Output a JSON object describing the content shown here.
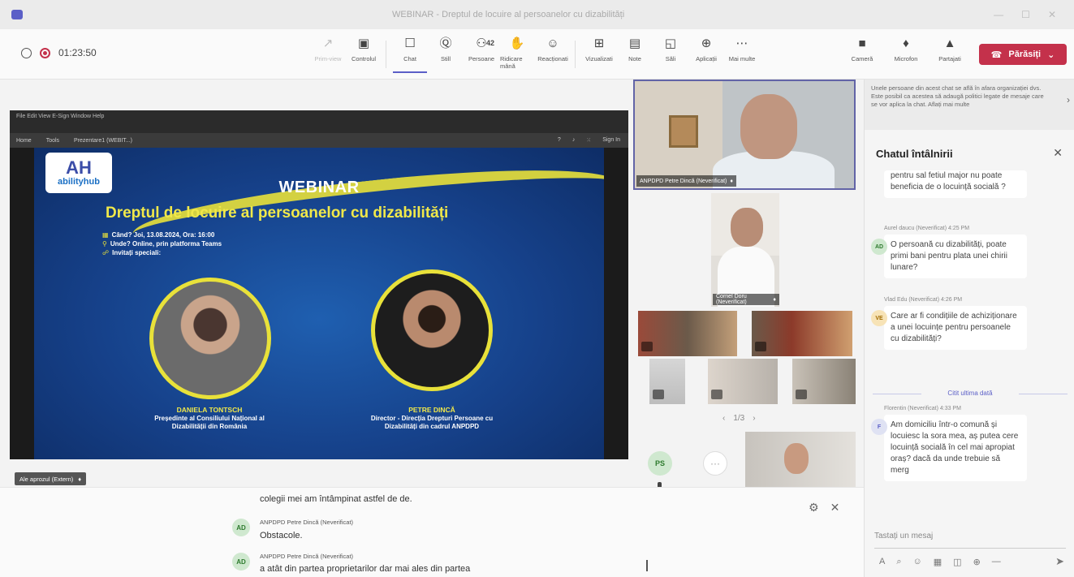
{
  "window": {
    "title": "WEBINAR - Dreptul de locuire al persoanelor cu dizabilități"
  },
  "meeting": {
    "timer": "01:23:50"
  },
  "toolbar": {
    "items": [
      {
        "label": "Prim-view",
        "icon": "↗",
        "dim": true
      },
      {
        "label": "Controlul",
        "icon": "▣",
        "dim": false
      },
      {
        "label": "Chat",
        "icon": "☐",
        "dim": false,
        "active": true
      },
      {
        "label": "Still",
        "icon": "Ⓠ",
        "dim": false
      },
      {
        "label": "Persoane",
        "icon": "⚇",
        "dim": false
      },
      {
        "label": "Ridicare mână",
        "icon": "✋",
        "dim": false
      },
      {
        "label": "Reacționati",
        "icon": "☺",
        "dim": false
      },
      {
        "label": "Vizualizati",
        "icon": "⊞",
        "dim": false
      },
      {
        "label": "Note",
        "icon": "▤",
        "dim": false
      },
      {
        "label": "Săli",
        "icon": "◱",
        "dim": false
      },
      {
        "label": "Aplicații",
        "icon": "⊕",
        "dim": false
      },
      {
        "label": "Mai multe",
        "icon": "⋯",
        "dim": false
      }
    ],
    "people_count": "42",
    "devices": [
      {
        "label": "Cameră",
        "icon": "■"
      },
      {
        "label": "Microfon",
        "icon": "♦"
      },
      {
        "label": "Partajati",
        "icon": "▲"
      }
    ],
    "leave_label": "Părăsiți"
  },
  "shared_screen": {
    "menubar": "File  Edit  View  E-Sign  Window  Help",
    "tabs": [
      "Home",
      "Tools",
      "Prezentare1 (WEBIT...)"
    ],
    "sign_in": "Sign In",
    "slide": {
      "logo_mark": "AH",
      "logo_text": "abilityhub",
      "title": "WEBINAR",
      "subtitle": "Dreptul de locuire al persoanelor cu dizabilități",
      "info": [
        {
          "bullet": "▦",
          "text": "Când? Joi, 13.08.2024, Ora: 16:00"
        },
        {
          "bullet": "⚲",
          "text": "Unde? Online, prin platforma Teams"
        },
        {
          "bullet": "☍",
          "text": "Invitați speciali:"
        }
      ],
      "speakers": [
        {
          "name": "DANIELA TONTSCH",
          "role": "Președinte al Consiliului Național al Dizabilității din România"
        },
        {
          "name": "PETRE DINCĂ",
          "role": "Director - Direcția Drepturi Persoane cu Dizabilități din cadrul ANPDPD"
        }
      ]
    },
    "presenter_label": "Ale aprozul (Extern)"
  },
  "video": {
    "main_label": "ANPDPD Petre Dincă (Neverificat)",
    "second_label": "Cornel Doru (Neverificat)",
    "pager": "1/3",
    "ps_initials": "PS"
  },
  "captions": [
    {
      "name": "",
      "initials": "",
      "text": "colegii mei am întâmpinat astfel de de."
    },
    {
      "name": "ANPDPD Petre Dincă (Neverificat)",
      "initials": "AD",
      "text": "Obstacole."
    },
    {
      "name": "ANPDPD Petre Dincă (Neverificat)",
      "initials": "AD",
      "text": "a atât din partea proprietarilor dar mai ales din partea"
    }
  ],
  "chat": {
    "notice": "Unele persoane din acest chat se află în afara organizației dvs. Este posibil ca acestea să adaugă politici legate de mesaje care se vor aplica la chat. Aflați mai multe",
    "title": "Chatul întâlnirii",
    "messages": [
      {
        "meta": "",
        "initials": "",
        "text": "pentru sal fetiul major nu poate beneficia de o locuință socială ?"
      },
      {
        "meta": "Aurel daucu (Neverificat)  4:25 PM",
        "initials": "AD",
        "text": "O persoană cu dizabilități, poate primi bani pentru plata unei chirii lunare?"
      },
      {
        "meta": "Vlad Edu (Neverificat)  4:26 PM",
        "initials": "VE",
        "text": "Care ar fi condițiile de achiziționare a unei locuințe pentru persoanele cu dizabilități?"
      },
      {
        "meta": "Florentin (Neverificat)  4:33 PM",
        "initials": "F",
        "text": "Am domiciliu într-o comună și locuiesc la sora mea, aș putea cere locuință socială în cel mai apropiat oraș? dacă da unde trebuie să merg"
      }
    ],
    "divider": "Citit ultima dată",
    "compose_placeholder": "Tastați un mesaj"
  },
  "colors": {
    "accent": "#5b5fc7",
    "leave": "#c4314b",
    "slide_bg": "#16418a",
    "slide_yellow": "#e8e13a"
  }
}
